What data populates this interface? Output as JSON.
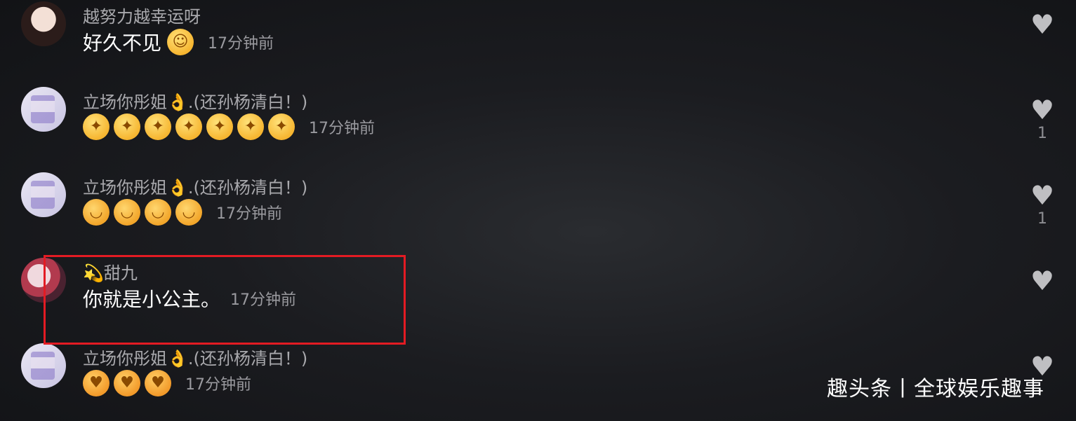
{
  "comments": [
    {
      "name": "越努力越幸运呀",
      "text": "好久不见",
      "emojis": [
        "grin"
      ],
      "time": "17分钟前",
      "likes": ""
    },
    {
      "name": "立场你彤姐👌.(还孙杨清白！)",
      "text": "",
      "emojis": [
        "star-eyes",
        "star-eyes",
        "star-eyes",
        "star-eyes",
        "star-eyes",
        "star-eyes",
        "star-eyes"
      ],
      "time": "17分钟前",
      "likes": "1"
    },
    {
      "name": "立场你彤姐👌.(还孙杨清白！)",
      "text": "",
      "emojis": [
        "blush",
        "blush",
        "blush",
        "blush"
      ],
      "time": "17分钟前",
      "likes": "1"
    },
    {
      "name": "💫甜九",
      "text": "你就是小公主。",
      "emojis": [],
      "time": "17分钟前",
      "likes": ""
    },
    {
      "name": "立场你彤姐👌.(还孙杨清白！)",
      "text": "",
      "emojis": [
        "kiss",
        "kiss",
        "kiss"
      ],
      "time": "17分钟前",
      "likes": ""
    }
  ],
  "watermark": "趣头条丨全球娱乐趣事",
  "colors": {
    "highlight": "#e31b23",
    "name": "#a9a9ad",
    "time": "#9a9a9f"
  }
}
